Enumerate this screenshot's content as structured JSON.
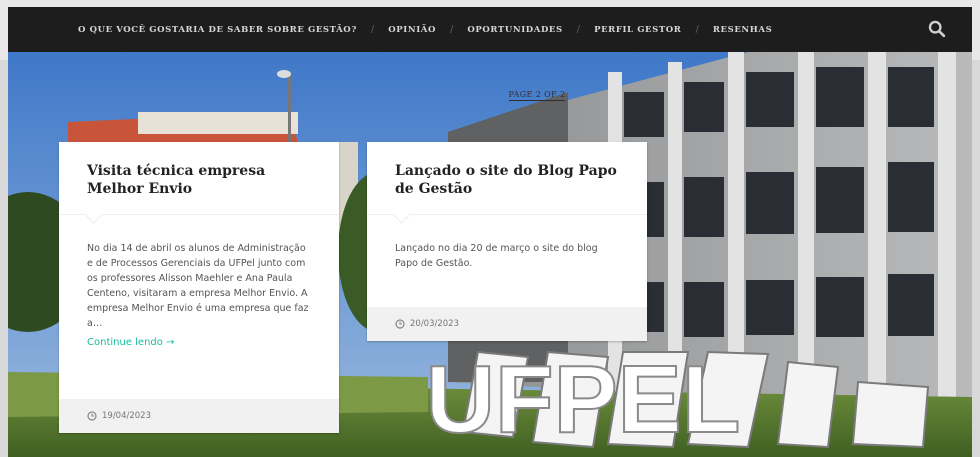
{
  "nav": {
    "items": [
      {
        "label": "O QUE VOCÊ GOSTARIA DE SABER SOBRE GESTÃO?"
      },
      {
        "label": "OPINIÃO"
      },
      {
        "label": "OPORTUNIDADES"
      },
      {
        "label": "PERFIL GESTOR"
      },
      {
        "label": "RESENHAS"
      }
    ],
    "separator": "/",
    "search_icon": "search-icon"
  },
  "pagination": {
    "label": "PAGE 2 OF 2"
  },
  "hero": {
    "sign_text": "UFPEL"
  },
  "posts": [
    {
      "title": "Visita técnica empresa Melhor Envio",
      "excerpt": "No dia 14 de abril os alunos de Administração e de Processos Gerenciais da UFPel junto com os professores Alisson Maehler e Ana Paula Centeno, visitaram a empresa Melhor Envio. A empresa Melhor Envio é uma empresa que faz a…",
      "read_more": "Continue lendo →",
      "date": "19/04/2023"
    },
    {
      "title": "Lançado o site do Blog Papo de Gestão",
      "excerpt": "Lançado no dia 20 de março o site do blog Papo de Gestão.",
      "date": "20/03/2023"
    }
  ],
  "colors": {
    "nav_bg": "#1d1d1d",
    "accent": "#1abc9c",
    "card_footer": "#f1f1f1"
  }
}
